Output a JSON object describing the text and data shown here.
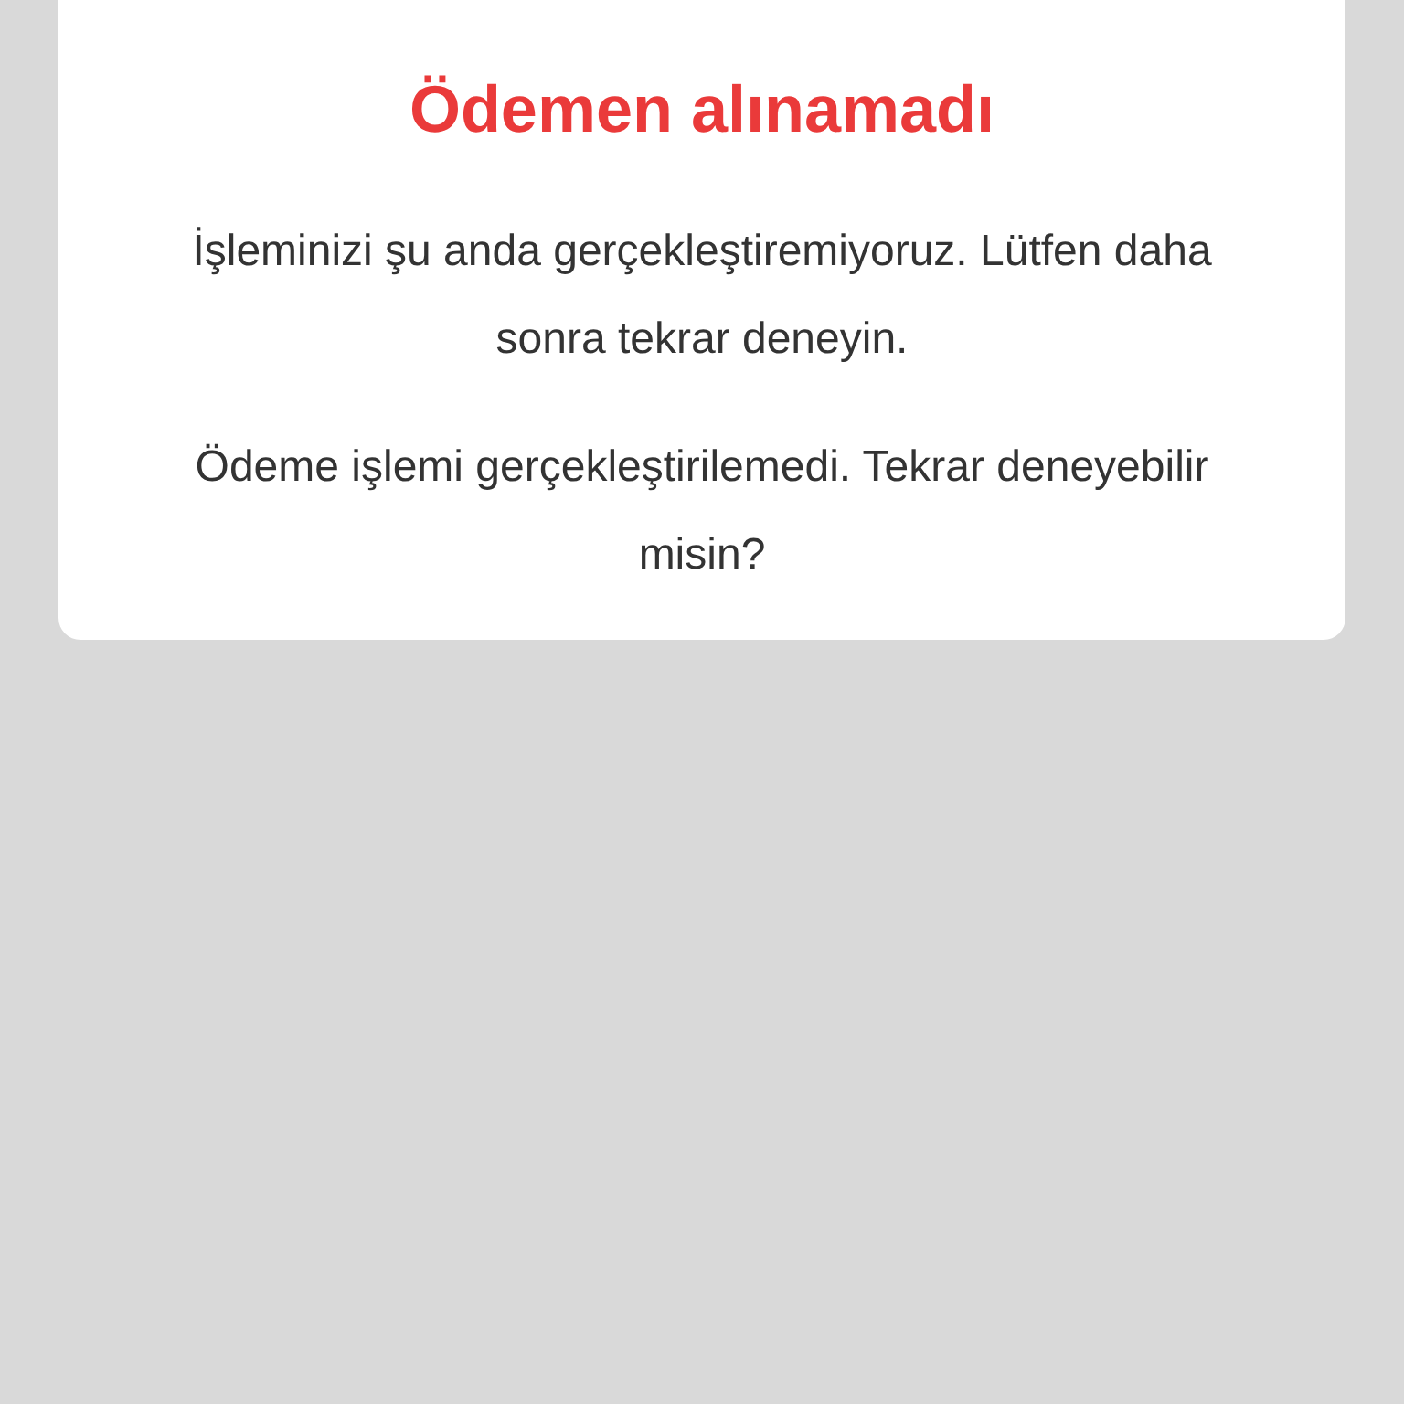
{
  "dialog": {
    "title": "Ödemen alınamadı",
    "paragraphs": [
      "İşleminizi şu anda gerçekleştiremiyoruz. Lütfen daha sonra tekrar deneyin.",
      "Ödeme işlemi gerçekleştirilemedi. Tekrar deneyebilir misin?"
    ]
  }
}
